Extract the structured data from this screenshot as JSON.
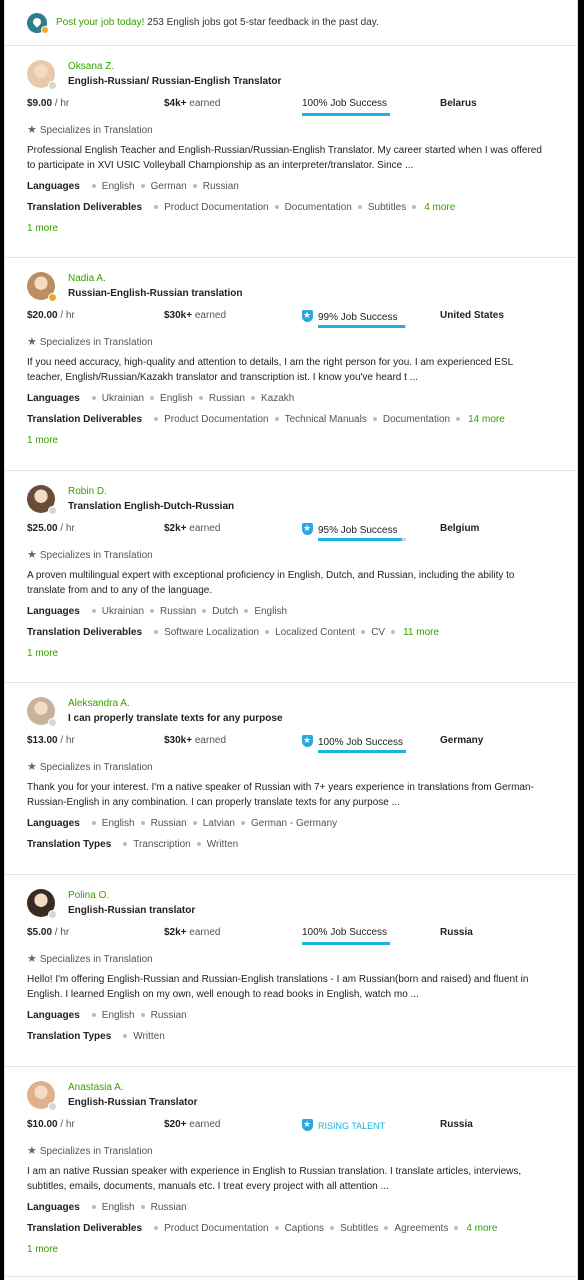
{
  "banner": {
    "highlight": "Post your job today!",
    "text": " 253 English jobs got 5-star feedback in the past day."
  },
  "colors": {
    "green": "#37a000",
    "blue": "#1cb2e4"
  },
  "freelancers": [
    {
      "name": "Oksana Z.",
      "title": "English-Russian/ Russian-English Translator",
      "rate": "$9.00",
      "rate_unit": " / hr",
      "earned": "$4k+",
      "earned_label": " earned",
      "job_success": "100% Job Success",
      "job_success_pct": 100,
      "top_rated": false,
      "country": "Belarus",
      "specializes": "Specializes in Translation",
      "description": "Professional English Teacher and English-Russian/Russian-English Translator. My career started when I was offered to participate in XVI USIC Volleyball Championship as an interpreter/translator. Since ...",
      "languages_label": "Languages",
      "languages": [
        "English",
        "German",
        "Russian"
      ],
      "deliverables_label": "Translation Deliverables",
      "deliverables": [
        "Product Documentation",
        "Documentation",
        "Subtitles"
      ],
      "deliverables_more": "4 more",
      "one_more": "1 more",
      "online": false
    },
    {
      "name": "Nadia A.",
      "title": "Russian-English-Russian translation",
      "rate": "$20.00",
      "rate_unit": " / hr",
      "earned": "$30k+",
      "earned_label": " earned",
      "job_success": "99% Job Success",
      "job_success_pct": 99,
      "top_rated": true,
      "country": "United States",
      "specializes": "Specializes in Translation",
      "description": "If you need accuracy, high-quality and attention to details, I am the right person for you. I am experienced ESL teacher, English/Russian/Kazakh translator and transcription ist. I know you've heard t ...",
      "languages_label": "Languages",
      "languages": [
        "Ukrainian",
        "English",
        "Russian",
        "Kazakh"
      ],
      "deliverables_label": "Translation Deliverables",
      "deliverables": [
        "Product Documentation",
        "Technical Manuals",
        "Documentation"
      ],
      "deliverables_more": "14 more",
      "one_more": "1 more",
      "online": true
    },
    {
      "name": "Robin D.",
      "title": "Translation English-Dutch-Russian",
      "rate": "$25.00",
      "rate_unit": " / hr",
      "earned": "$2k+",
      "earned_label": " earned",
      "job_success": "95% Job Success",
      "job_success_pct": 95,
      "top_rated": true,
      "country": "Belgium",
      "specializes": "Specializes in Translation",
      "description": "A proven multilingual expert with exceptional proficiency in English, Dutch, and Russian, including the ability to translate from and to any of the language.",
      "languages_label": "Languages",
      "languages": [
        "Ukrainian",
        "Russian",
        "Dutch",
        "English"
      ],
      "deliverables_label": "Translation Deliverables",
      "deliverables": [
        "Software Localization",
        "Localized Content",
        "CV"
      ],
      "deliverables_more": "11 more",
      "one_more": "1 more",
      "online": false
    },
    {
      "name": "Aleksandra A.",
      "title": "I can properly translate texts for any purpose",
      "rate": "$13.00",
      "rate_unit": " / hr",
      "earned": "$30k+",
      "earned_label": " earned",
      "job_success": "100% Job Success",
      "job_success_pct": 100,
      "top_rated": true,
      "country": "Germany",
      "specializes": "Specializes in Translation",
      "description": "Thank you for your interest. I'm a native speaker of Russian with 7+ years experience in translations from German-Russian-English in any combination. I can properly translate texts for any purpose ...",
      "languages_label": "Languages",
      "languages": [
        "English",
        "Russian",
        "Latvian",
        "German - Germany"
      ],
      "deliverables_label": "Translation Types",
      "deliverables": [
        "Transcription",
        "Written"
      ],
      "deliverables_more": "",
      "one_more": "",
      "online": false
    },
    {
      "name": "Polina O.",
      "title": "English-Russian translator",
      "rate": "$5.00",
      "rate_unit": " / hr",
      "earned": "$2k+",
      "earned_label": " earned",
      "job_success": "100% Job Success",
      "job_success_pct": 100,
      "top_rated": false,
      "country": "Russia",
      "specializes": "Specializes in Translation",
      "description": "Hello! I'm offering English-Russian and Russian-English translations - I am Russian(born and raised) and fluent in English. I learned English on my own, well enough to read books in English, watch mo ...",
      "languages_label": "Languages",
      "languages": [
        "English",
        "Russian"
      ],
      "deliverables_label": "Translation Types",
      "deliverables": [
        "Written"
      ],
      "deliverables_more": "",
      "one_more": "",
      "online": false
    },
    {
      "name": "Anastasia A.",
      "title": "English-Russian Translator",
      "rate": "$10.00",
      "rate_unit": " / hr",
      "earned": "$20+",
      "earned_label": " earned",
      "job_success": "RISING TALENT",
      "job_success_pct": null,
      "top_rated": false,
      "rising_talent": true,
      "country": "Russia",
      "specializes": "Specializes in Translation",
      "description": "I am an native Russian speaker with experience in English to Russian translation. I translate articles, interviews, subtitles, emails, documents, manuals etc. I treat every project with all attention ...",
      "languages_label": "Languages",
      "languages": [
        "English",
        "Russian"
      ],
      "deliverables_label": "Translation Deliverables",
      "deliverables": [
        "Product Documentation",
        "Captions",
        "Subtitles",
        "Agreements"
      ],
      "deliverables_more": "4 more",
      "one_more": "1 more",
      "online": false
    }
  ]
}
